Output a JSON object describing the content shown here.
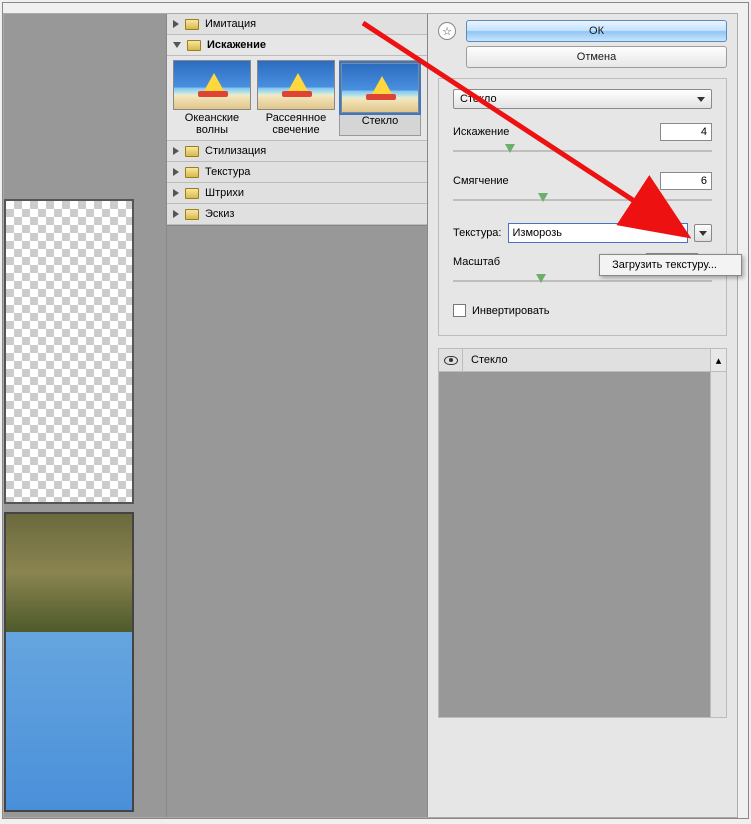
{
  "categories": {
    "imitation": "Имитация",
    "distortion": "Искажение",
    "stylization": "Стилизация",
    "texture": "Текстура",
    "strokes": "Штрихи",
    "sketch": "Эскиз"
  },
  "filters": [
    {
      "label": "Океанские волны"
    },
    {
      "label": "Рассеянное свечение"
    },
    {
      "label": "Стекло"
    }
  ],
  "buttons": {
    "ok": "ОК",
    "cancel": "Отмена"
  },
  "filterName": "Стекло",
  "params": {
    "distortion": {
      "label": "Искажение",
      "value": "4"
    },
    "smoothing": {
      "label": "Смягчение",
      "value": "6"
    },
    "textureLabel": "Текстура:",
    "textureValue": "Изморозь",
    "scaleLabel": "Масштаб",
    "invertLabel": "Инвертировать"
  },
  "popup": {
    "loadTexture": "Загрузить текстуру..."
  },
  "layer": {
    "name": "Стекло"
  },
  "glyphs": {
    "collapse": "☆",
    "scrollUp": "▴",
    "scrollDown": "▾"
  }
}
